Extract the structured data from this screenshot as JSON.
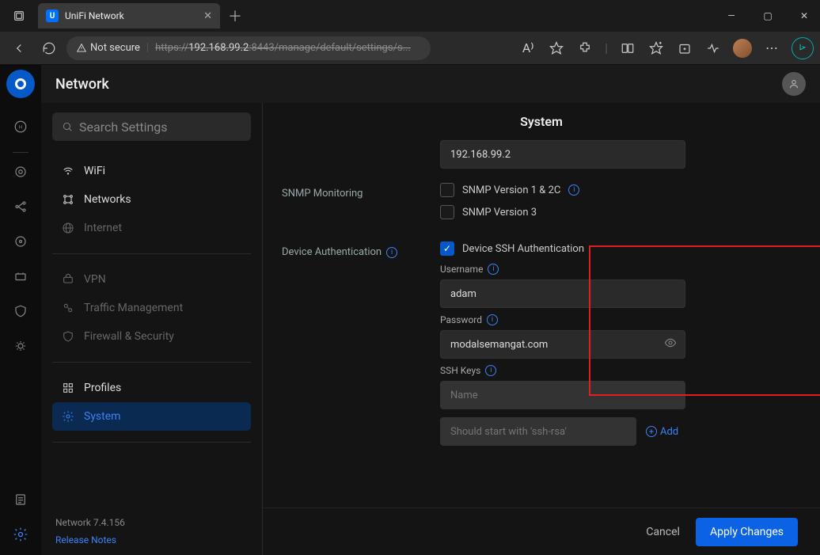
{
  "window": {
    "tab_title": "UniFi Network"
  },
  "address": {
    "not_secure": "Not secure",
    "url_prefix": "https://",
    "url_host": "192.168.99.2",
    "url_rest": ":8443/manage/default/settings/s..."
  },
  "app": {
    "title": "Network",
    "search_placeholder": "Search Settings",
    "version": "Network 7.4.156",
    "release_notes": "Release Notes"
  },
  "nav": {
    "wifi": "WiFi",
    "networks": "Networks",
    "internet": "Internet",
    "vpn": "VPN",
    "traffic": "Traffic Management",
    "firewall": "Firewall & Security",
    "profiles": "Profiles",
    "system": "System"
  },
  "page": {
    "title": "System",
    "inform_host": "192.168.99.2",
    "snmp_label": "SNMP Monitoring",
    "snmp_v12": "SNMP Version 1 & 2C",
    "snmp_v3": "SNMP Version 3",
    "device_auth_label": "Device Authentication",
    "device_ssh_auth": "Device SSH Authentication",
    "username_label": "Username",
    "username_value": "adam",
    "password_label": "Password",
    "password_value": "modalsemangat.com",
    "ssh_keys_label": "SSH Keys",
    "ssh_name_placeholder": "Name",
    "ssh_key_placeholder": "Should start with 'ssh-rsa'",
    "add": "Add",
    "cancel": "Cancel",
    "apply": "Apply Changes"
  }
}
